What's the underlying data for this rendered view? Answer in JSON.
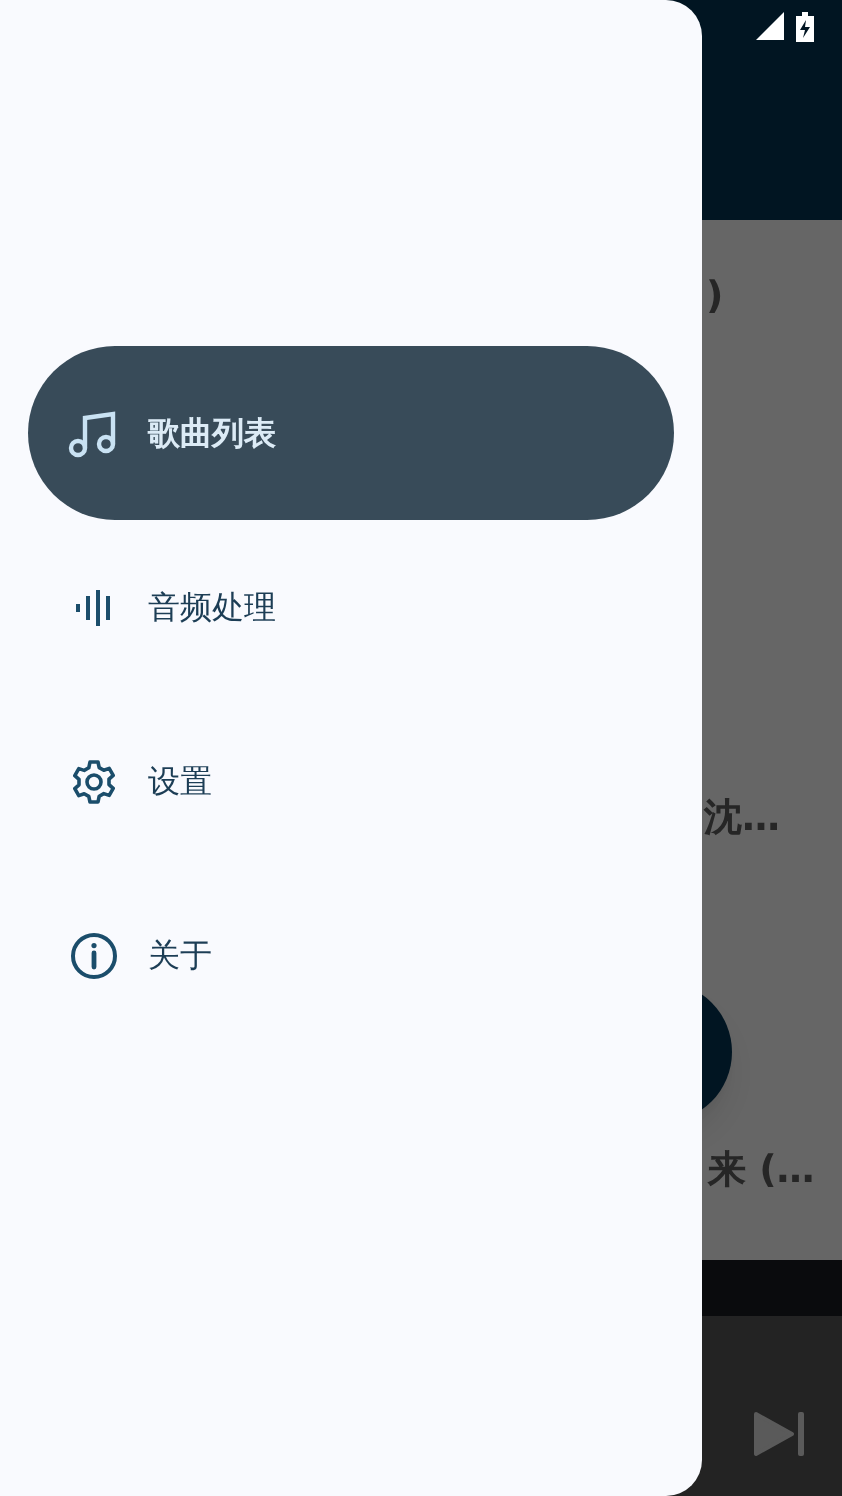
{
  "background": {
    "texts": [
      ")",
      "沈…",
      "来 (…"
    ]
  },
  "drawer": {
    "items": [
      {
        "label": "歌曲列表",
        "selected": true
      },
      {
        "label": "音频处理",
        "selected": false
      },
      {
        "label": "设置",
        "selected": false
      },
      {
        "label": "关于",
        "selected": false
      }
    ]
  }
}
